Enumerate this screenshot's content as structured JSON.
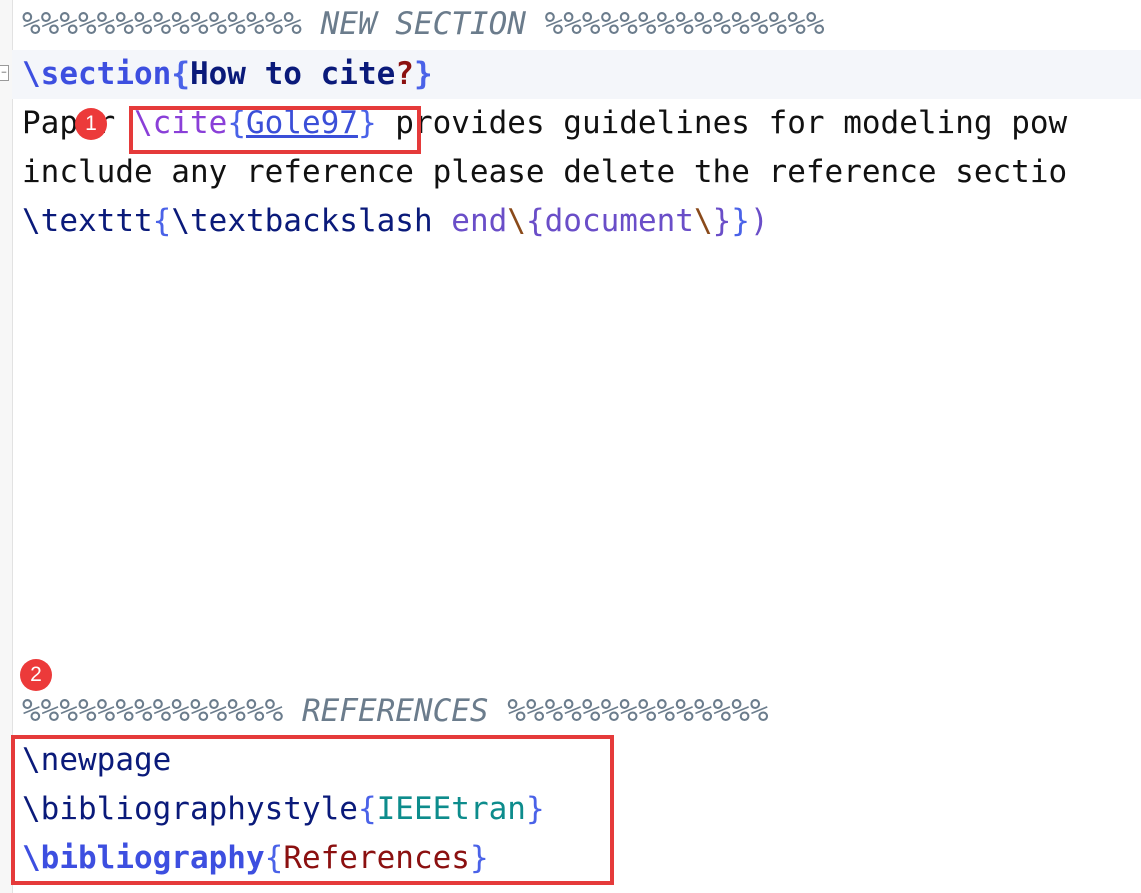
{
  "editor": {
    "lines": {
      "section_comment": "%%%%%%%%%%%%%%% NEW SECTION %%%%%%%%%%%%%%%",
      "section_cmd": "\\section",
      "section_title": "How to cite",
      "section_q": "?",
      "para1_start": "Paper ",
      "cite_cmd": "\\cite",
      "cite_key": "Gole97",
      "para1_end": " provides guidelines for modeling pow",
      "para2": "include any reference please delete the reference sectio",
      "texttt_cmd": "\\texttt",
      "textbackslash_cmd": "\\textbackslash",
      "end_word": " end",
      "document_word": "document",
      "close_paren": ")",
      "refs_comment": "%%%%%%%%%%%%%% REFERENCES %%%%%%%%%%%%%%",
      "newpage_cmd": "\\newpage",
      "bibstyle_cmd": "\\bibliographystyle",
      "bibstyle_arg": "IEEEtran",
      "bib_cmd": "\\bibliography",
      "bib_arg": "References"
    }
  },
  "annotations": {
    "badge1": "1",
    "badge2": "2",
    "box_color": "#e53a3a"
  }
}
